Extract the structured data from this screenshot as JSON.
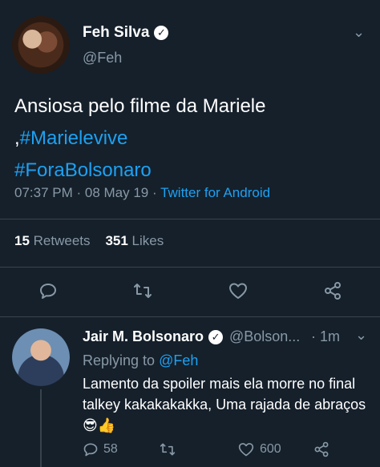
{
  "main_tweet": {
    "display_name": "Feh Silva",
    "handle": "@Feh",
    "text": "Ansiosa pelo filme da Mariele ,",
    "hashtag1": "#Marielevive",
    "hashtag2": "#ForaBolsonaro",
    "time_date": "07:37 PM · 08 May 19 ·",
    "source": "Twitter for Android",
    "retweets_count": "15",
    "retweets_label": "Retweets",
    "likes_count": "351",
    "likes_label": "Likes"
  },
  "reply": {
    "display_name": "Jair M. Bolsonaro",
    "handle": "@Bolson...",
    "time": "· 1m",
    "replying_prefix": "Replying to",
    "replying_handle": "@Feh",
    "text": "Lamento da spoiler mais ela morre no final talkey  kakakakakka,  Uma rajada de abraços",
    "emoji": "😎👍",
    "reply_count": "58",
    "like_count": "600"
  },
  "colors": {
    "background": "#15202b",
    "accent": "#1da1f2",
    "muted": "#8899a6",
    "divider": "#38444d"
  },
  "icons": [
    "verified-badge-icon",
    "chevron-down-icon",
    "reply-icon",
    "retweet-icon",
    "like-icon",
    "share-icon"
  ]
}
